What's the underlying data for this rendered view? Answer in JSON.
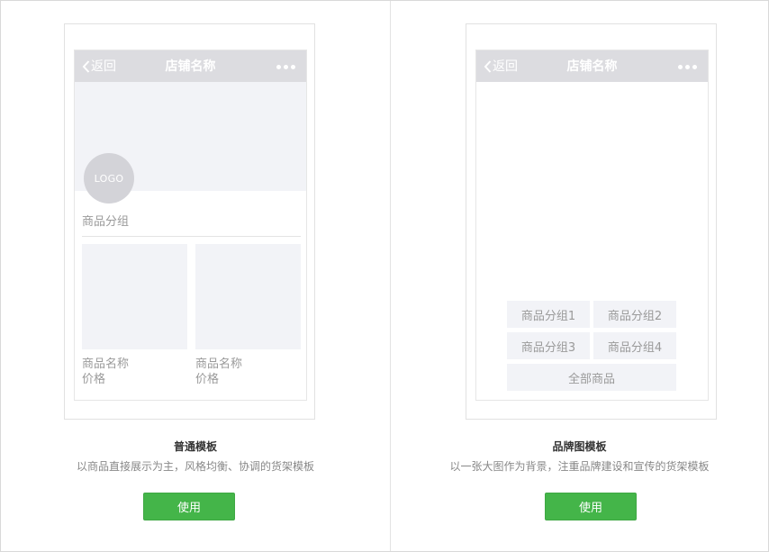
{
  "templates": [
    {
      "nav": {
        "back_label": "返回",
        "title": "店铺名称"
      },
      "logo_text": "LOGO",
      "group_title": "商品分组",
      "goods": [
        {
          "name": "商品名称",
          "price": "价格"
        },
        {
          "name": "商品名称",
          "price": "价格"
        }
      ],
      "title": "普通模板",
      "description": "以商品直接展示为主，风格均衡、协调的货架模板",
      "use_label": "使用"
    },
    {
      "nav": {
        "back_label": "返回",
        "title": "店铺名称"
      },
      "groups": [
        "商品分组1",
        "商品分组2",
        "商品分组3",
        "商品分组4"
      ],
      "all_goods": "全部商品",
      "title": "品牌图模板",
      "description": "以一张大图作为背景，注重品牌建设和宣传的货架模板",
      "use_label": "使用"
    }
  ],
  "colors": {
    "accent_button": "#44b549",
    "navbar": "#dcdce0",
    "placeholder": "#f2f3f7"
  }
}
